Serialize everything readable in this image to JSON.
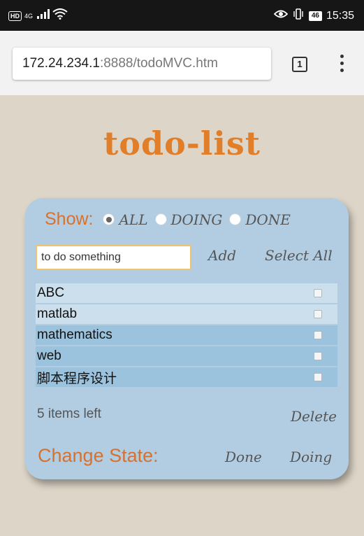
{
  "status_bar": {
    "hd_badge": "HD",
    "network": "4G",
    "time": "15:35",
    "battery": "46"
  },
  "browser": {
    "url_host": "172.24.234.1",
    "url_path": ":8888/todoMVC.htm",
    "tab_count": "1"
  },
  "app": {
    "title": "todo-list"
  },
  "filter": {
    "label": "Show:",
    "options": [
      {
        "label": "ALL",
        "checked": true
      },
      {
        "label": "DOING",
        "checked": false
      },
      {
        "label": "DONE",
        "checked": false
      }
    ]
  },
  "input": {
    "placeholder": "to do something",
    "add_label": "Add",
    "select_all_label": "Select All"
  },
  "todos": [
    {
      "text": "ABC",
      "checked": false
    },
    {
      "text": "matlab",
      "checked": false
    },
    {
      "text": "mathematics",
      "checked": false
    },
    {
      "text": "web",
      "checked": false
    },
    {
      "text": "脚本程序设计",
      "checked": false
    }
  ],
  "footer": {
    "items_left": "5 items left",
    "delete_label": "Delete",
    "change_state_label": "Change State:",
    "done_label": "Done",
    "doing_label": "Doing"
  },
  "colors": {
    "accent_orange": "#e17e2a",
    "card_bg": "#b2cde2",
    "page_bg": "#ddd5c7"
  }
}
